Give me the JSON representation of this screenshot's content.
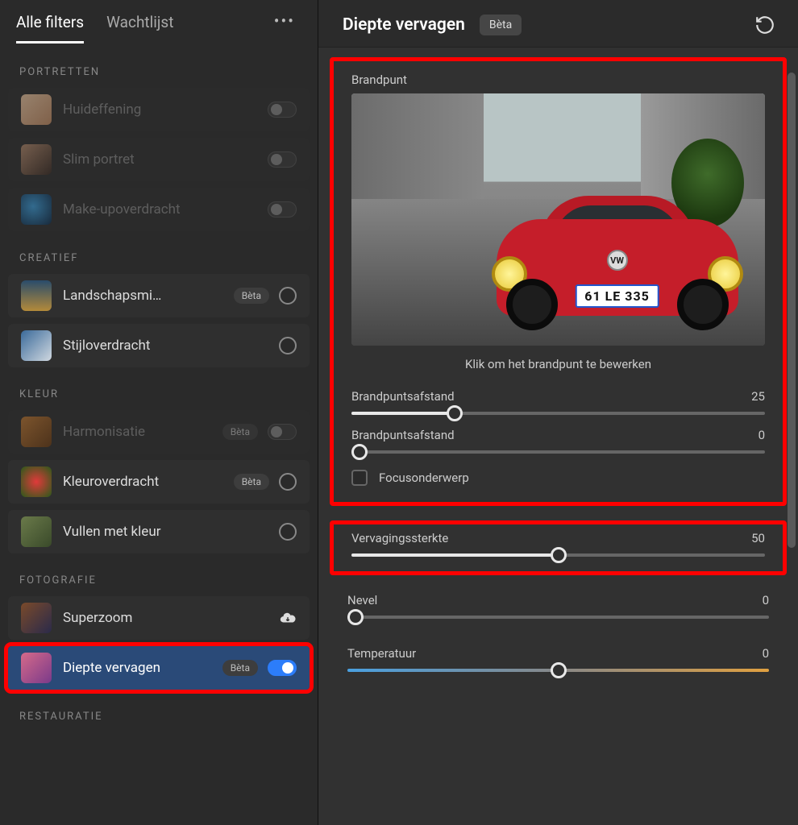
{
  "tabs": {
    "all_filters": "Alle filters",
    "watchlist": "Wachtlijst"
  },
  "sections": {
    "portraits": "PORTRETTEN",
    "creative": "CREATIEF",
    "color": "KLEUR",
    "photography": "FOTOGRAFIE",
    "restoration": "RESTAURATIE"
  },
  "filters": {
    "skin_smoothing": "Huideffening",
    "smart_portrait": "Slim portret",
    "makeup_transfer": "Make-upoverdracht",
    "landscape_mixer": "Landschapsmi…",
    "style_transfer": "Stijloverdracht",
    "harmonization": "Harmonisatie",
    "color_transfer": "Kleuroverdracht",
    "colorize": "Vullen met kleur",
    "superzoom": "Superzoom",
    "depth_blur": "Diepte vervagen"
  },
  "beta_label": "Bèta",
  "panel": {
    "title": "Diepte vervagen",
    "brandpunt": "Brandpunt",
    "preview_caption": "Klik om het brandpunt te bewerken",
    "license_plate": "61 LE 335",
    "vw": "VW",
    "focal_distance": "Brandpuntsafstand",
    "focal_distance_value": "25",
    "focal_range": "Brandpuntsafstand",
    "focal_range_value": "0",
    "focus_subject": "Focusonderwerp",
    "blur_strength": "Vervagingssterkte",
    "blur_strength_value": "50",
    "haze": "Nevel",
    "haze_value": "0",
    "temperature": "Temperatuur",
    "temperature_value": "0"
  }
}
